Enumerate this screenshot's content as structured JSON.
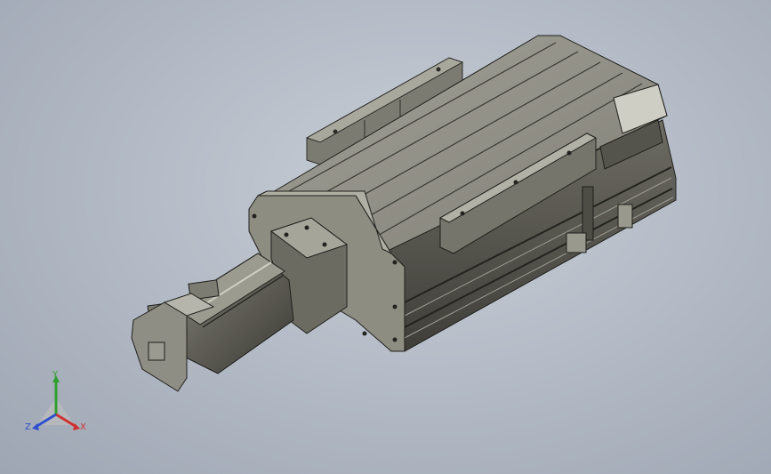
{
  "viewport": {
    "background_top": "#c9ced6",
    "background_bottom": "#9ea6b3"
  },
  "model": {
    "body_color": "#8c8b80",
    "dark_color": "#3c3c37",
    "highlight_color": "#cfcec4"
  },
  "triad": {
    "x_label": "X",
    "y_label": "Y",
    "z_label": "Z",
    "x_color": "#d03030",
    "y_color": "#2fa02f",
    "z_color": "#2f4fd0"
  }
}
